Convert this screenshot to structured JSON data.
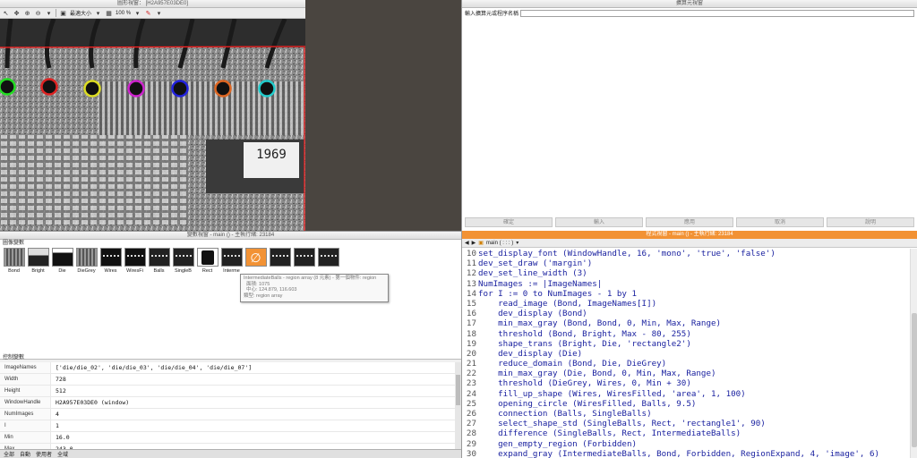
{
  "graphics": {
    "title": "圖形視窗： [H2A957E03DE0]",
    "toolbar": {
      "zoom_mode": "最適大小",
      "zoom_pct": "100 %"
    },
    "image": {
      "circles": [
        {
          "color": "#22dd22"
        },
        {
          "color": "#dd2222"
        },
        {
          "color": "#dddd22"
        },
        {
          "color": "#cc22cc"
        },
        {
          "color": "#2222dd"
        },
        {
          "color": "#dd6622"
        },
        {
          "color": "#22cccc"
        }
      ],
      "die_text": "1969",
      "boundary_color": "#ff2222"
    }
  },
  "input": {
    "title": "擴算元視窗",
    "prompt_label": "輸入擴算元或程序名稱",
    "buttons": [
      "確定",
      "輸入",
      "應用",
      "取消",
      "說明"
    ]
  },
  "variables": {
    "title": "變數視窗 - main () - 主執行緒: 23184",
    "iconic_label": "圖像變數",
    "control_label": "控制變數",
    "iconic": [
      {
        "label": "Bond",
        "kind": "photo"
      },
      {
        "label": "Bright",
        "kind": "bright"
      },
      {
        "label": "Die",
        "kind": "die"
      },
      {
        "label": "DieGrey",
        "kind": "photo"
      },
      {
        "label": "Wires",
        "kind": "wires"
      },
      {
        "label": "WiresFi",
        "kind": "wires"
      },
      {
        "label": "Balls",
        "kind": "balls"
      },
      {
        "label": "SingleB",
        "kind": "balls"
      },
      {
        "label": "Rect",
        "kind": "rect"
      },
      {
        "label": "Interme",
        "kind": "balls"
      },
      {
        "label": "",
        "kind": "empty"
      },
      {
        "label": "",
        "kind": "balls"
      },
      {
        "label": "",
        "kind": "balls"
      },
      {
        "label": "",
        "kind": "balls"
      }
    ],
    "tooltip": {
      "line1": "IntermediateBalls - region array (8 元素) - 第一個物件: region",
      "line2": "面積: 1075",
      "line3": "中心: 124.879, 116.603",
      "line4": "類型: region array"
    },
    "control": [
      {
        "name": "ImageNames",
        "value": "['die/die_02', 'die/die_03', 'die/die_04', 'die/die_07']"
      },
      {
        "name": "Width",
        "value": "728"
      },
      {
        "name": "Height",
        "value": "512"
      },
      {
        "name": "WindowHandle",
        "value": "H2A957E03DE0 (window)"
      },
      {
        "name": "NumImages",
        "value": "4"
      },
      {
        "name": "I",
        "value": "1"
      },
      {
        "name": "Min",
        "value": "16.0"
      },
      {
        "name": "Max",
        "value": "243.0"
      }
    ],
    "tabs": [
      "全部",
      "自動",
      "使用者",
      "全域"
    ]
  },
  "program": {
    "title": "程式視窗 - main () - 主執行緒: 23184",
    "procedure": "main ( : : : )",
    "lines": [
      {
        "n": "10",
        "code": "set_display_font (WindowHandle, 16, 'mono', 'true', 'false')"
      },
      {
        "n": "11",
        "code": "dev_set_draw ('margin')"
      },
      {
        "n": "12",
        "code": "dev_set_line_width (3)"
      },
      {
        "n": "13",
        "code": "NumImages := |ImageNames|"
      },
      {
        "n": "14",
        "code": "for I := 0 to NumImages - 1 by 1"
      },
      {
        "n": "15",
        "code": "    read_image (Bond, ImageNames[I])"
      },
      {
        "n": "16",
        "code": "    dev_display (Bond)"
      },
      {
        "n": "17",
        "code": "    min_max_gray (Bond, Bond, 0, Min, Max, Range)"
      },
      {
        "n": "18",
        "code": "    threshold (Bond, Bright, Max - 80, 255)"
      },
      {
        "n": "19",
        "code": "    shape_trans (Bright, Die, 'rectangle2')"
      },
      {
        "n": "20",
        "code": "    dev_display (Die)"
      },
      {
        "n": "21",
        "code": "    reduce_domain (Bond, Die, DieGrey)"
      },
      {
        "n": "22",
        "code": "    min_max_gray (Die, Bond, 0, Min, Max, Range)"
      },
      {
        "n": "23",
        "code": "    threshold (DieGrey, Wires, 0, Min + 30)"
      },
      {
        "n": "24",
        "code": "    fill_up_shape (Wires, WiresFilled, 'area', 1, 100)"
      },
      {
        "n": "25",
        "code": "    opening_circle (WiresFilled, Balls, 9.5)"
      },
      {
        "n": "26",
        "code": "    connection (Balls, SingleBalls)"
      },
      {
        "n": "27",
        "code": "    select_shape_std (SingleBalls, Rect, 'rectangle1', 90)"
      },
      {
        "n": "28",
        "code": "    difference (SingleBalls, Rect, IntermediateBalls)"
      },
      {
        "n": "29",
        "code": "    gen_empty_region (Forbidden)"
      },
      {
        "n": "30",
        "code": "    expand_gray (IntermediateBalls, Bond, Forbidden, RegionExpand, 4, 'image', 6)"
      }
    ]
  },
  "colors": {
    "accent": "#f29234",
    "code": "#1b22a0",
    "background": "#4a4540"
  }
}
